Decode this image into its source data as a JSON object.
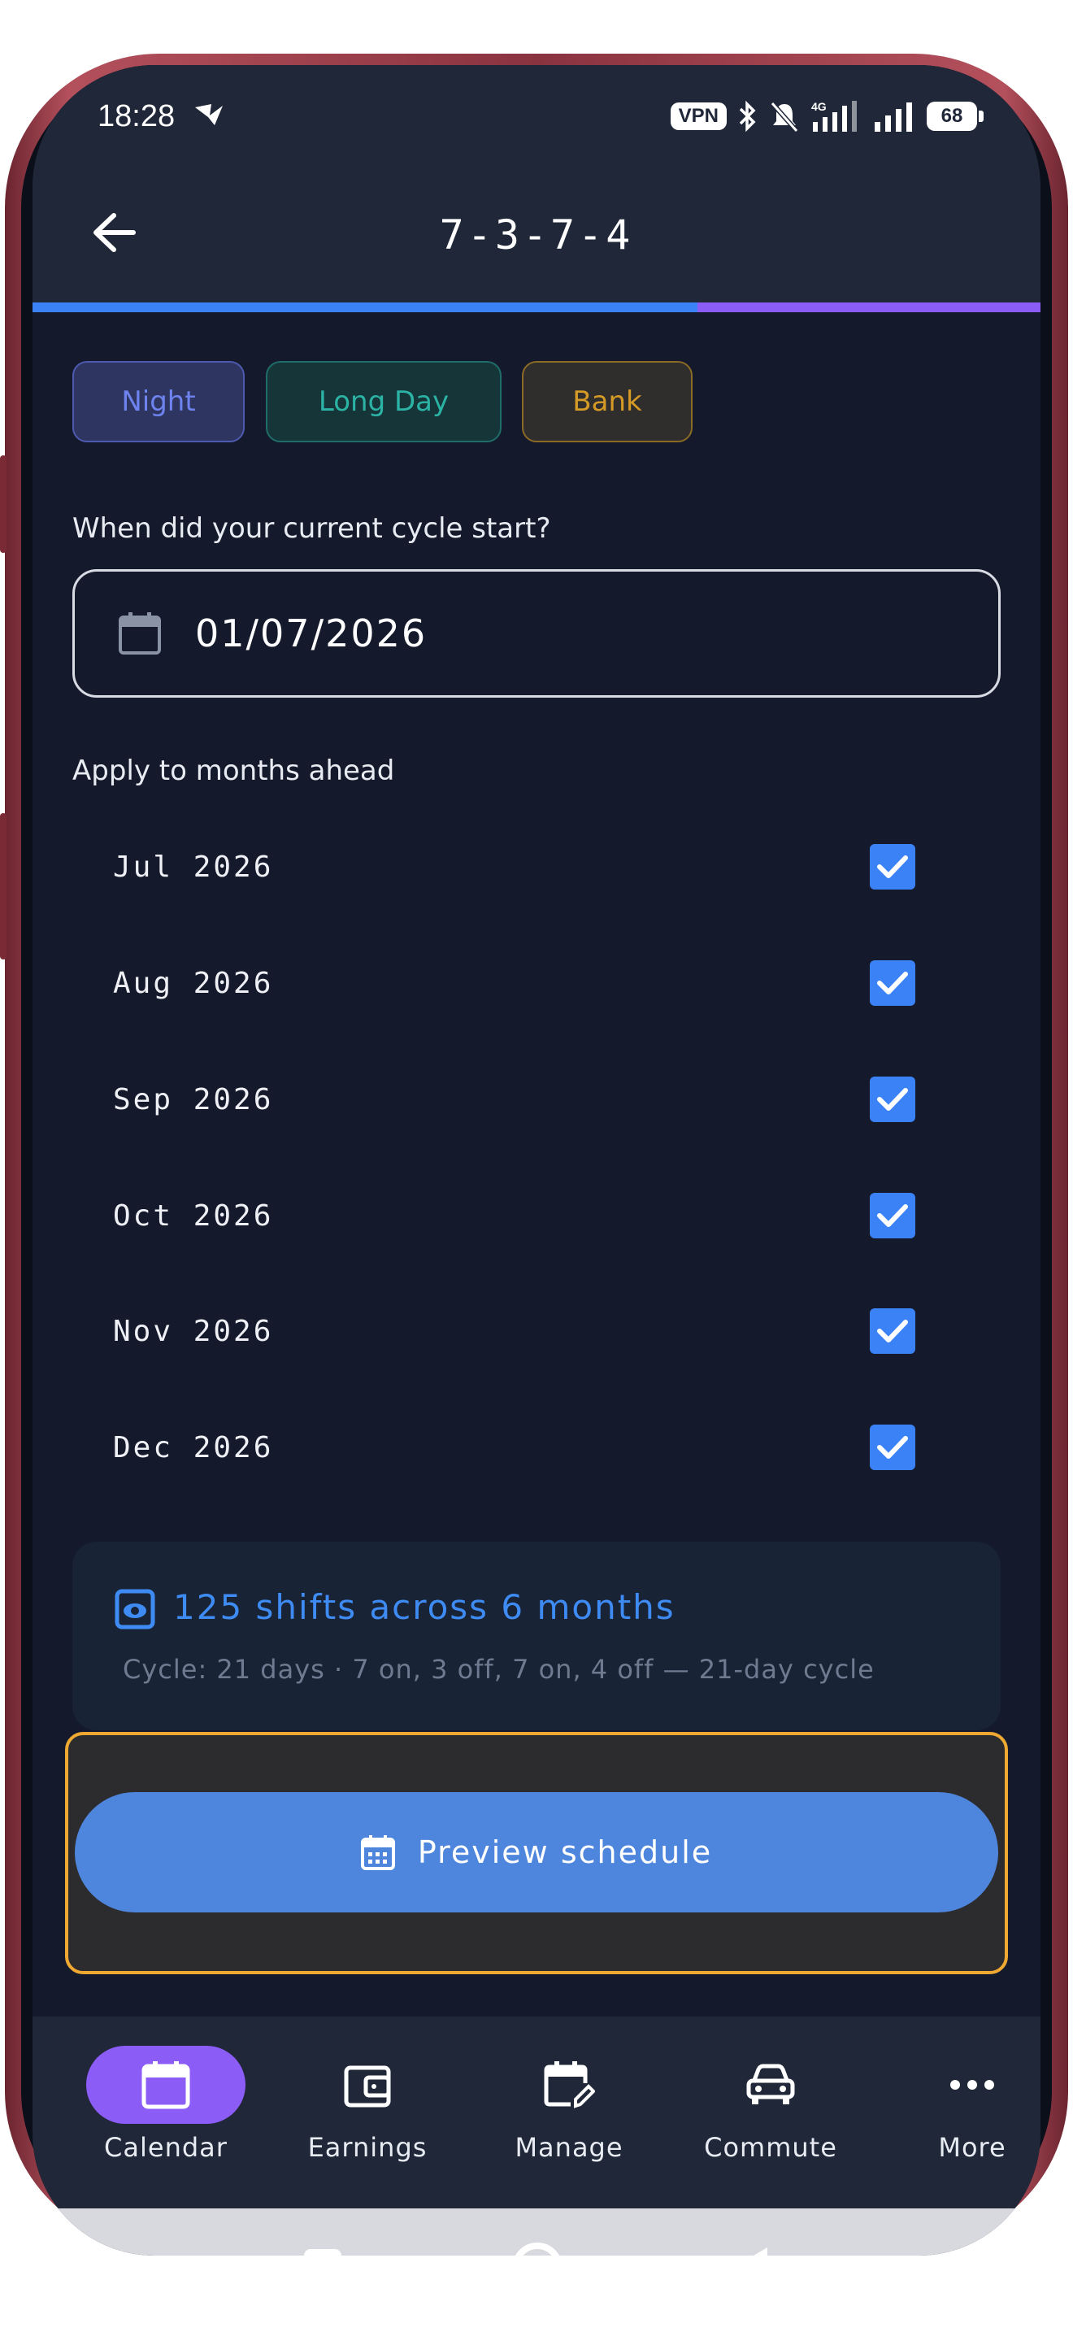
{
  "status_bar": {
    "time": "18:28",
    "vpn": "VPN",
    "battery": "68"
  },
  "header": {
    "title": "7-3-7-4",
    "progress_fraction": 0.66
  },
  "shift_types": [
    {
      "label": "Night",
      "color": "#6f83ef"
    },
    {
      "label": "Long Day",
      "color": "#2bb3a5"
    },
    {
      "label": "Bank",
      "color": "#d69a26"
    }
  ],
  "cycle_start": {
    "question": "When did your current cycle start?",
    "date": "01/07/2026"
  },
  "months": {
    "label": "Apply to months ahead",
    "items": [
      {
        "label": "Jul 2026",
        "checked": true
      },
      {
        "label": "Aug 2026",
        "checked": true
      },
      {
        "label": "Sep 2026",
        "checked": true
      },
      {
        "label": "Oct 2026",
        "checked": true
      },
      {
        "label": "Nov 2026",
        "checked": true
      },
      {
        "label": "Dec 2026",
        "checked": true
      }
    ]
  },
  "summary": {
    "title": "125 shifts across 6 months",
    "subtitle": "Cycle: 21 days · 7 on, 3 off, 7 on, 4 off — 21-day cycle"
  },
  "preview_button": {
    "label": "Preview schedule"
  },
  "bottom_nav": [
    {
      "label": "Calendar",
      "icon": "calendar-icon",
      "active": true
    },
    {
      "label": "Earnings",
      "icon": "wallet-icon",
      "active": false
    },
    {
      "label": "Manage",
      "icon": "calendar-edit-icon",
      "active": false
    },
    {
      "label": "Commute",
      "icon": "car-icon",
      "active": false
    },
    {
      "label": "More",
      "icon": "more-icon",
      "active": false
    }
  ],
  "colors": {
    "accent": "#3b82f6",
    "active_nav": "#8b5cf6",
    "background": "#141a2b",
    "highlight_border": "#efa933"
  }
}
